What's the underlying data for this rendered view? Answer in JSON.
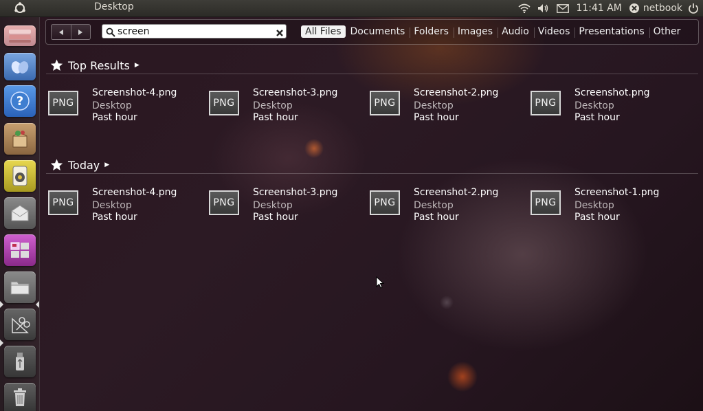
{
  "panel": {
    "title": "Desktop",
    "clock": "11:41 AM",
    "user": "netbook"
  },
  "search": {
    "value": "screen"
  },
  "filters": [
    {
      "label": "All Files",
      "active": true
    },
    {
      "label": "Documents"
    },
    {
      "label": "Folders"
    },
    {
      "label": "Images"
    },
    {
      "label": "Audio"
    },
    {
      "label": "Videos"
    },
    {
      "label": "Presentations"
    },
    {
      "label": "Other"
    }
  ],
  "sections": {
    "top": {
      "label": "Top Results",
      "items": [
        {
          "icon_text": "PNG",
          "name": "Screenshot-4.png",
          "location": "Desktop",
          "time": "Past hour"
        },
        {
          "icon_text": "PNG",
          "name": "Screenshot-3.png",
          "location": "Desktop",
          "time": "Past hour"
        },
        {
          "icon_text": "PNG",
          "name": "Screenshot-2.png",
          "location": "Desktop",
          "time": "Past hour"
        },
        {
          "icon_text": "PNG",
          "name": "Screenshot.png",
          "location": "Desktop",
          "time": "Past hour"
        }
      ]
    },
    "today": {
      "label": "Today",
      "items": [
        {
          "icon_text": "PNG",
          "name": "Screenshot-4.png",
          "location": "Desktop",
          "time": "Past hour"
        },
        {
          "icon_text": "PNG",
          "name": "Screenshot-3.png",
          "location": "Desktop",
          "time": "Past hour"
        },
        {
          "icon_text": "PNG",
          "name": "Screenshot-2.png",
          "location": "Desktop",
          "time": "Past hour"
        },
        {
          "icon_text": "PNG",
          "name": "Screenshot-1.png",
          "location": "Desktop",
          "time": "Past hour"
        }
      ]
    }
  },
  "launcher": [
    {
      "icon": "workspaces-icon",
      "color": "#c8a0a8"
    },
    {
      "icon": "applications-icon",
      "color": "#4a7fc0"
    },
    {
      "icon": "help-icon",
      "color": "#3a7ed0"
    },
    {
      "icon": "software-center-icon",
      "color": "#a07a55"
    },
    {
      "icon": "rhythmbox-icon",
      "color": "#c4b430"
    },
    {
      "icon": "mail-icon",
      "color": "#707070"
    },
    {
      "icon": "workspace-switcher-icon",
      "color": "#b04ab0"
    },
    {
      "icon": "files-icon",
      "color": "#6a6a6a"
    },
    {
      "icon": "screenshot-tool-icon",
      "color": "#555555"
    },
    {
      "icon": "usb-drive-icon",
      "color": "#4c4c4c"
    },
    {
      "icon": "trash-icon",
      "color": "#4c4c4c"
    }
  ]
}
